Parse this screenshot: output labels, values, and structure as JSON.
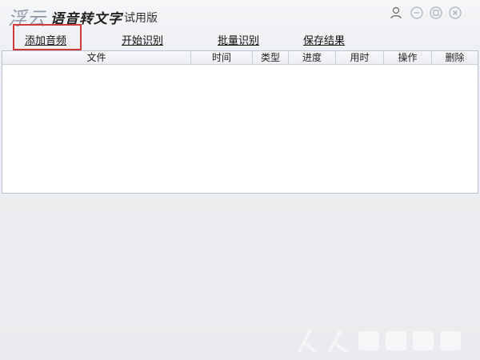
{
  "app": {
    "logo": "浮云",
    "title": "语音转文字",
    "edition": "试用版"
  },
  "window_controls": {
    "icons": [
      "user-icon",
      "minimize-icon",
      "maximize-icon",
      "close-icon"
    ]
  },
  "toolbar": {
    "add_audio": "添加音频",
    "start_recognition": "开始识别",
    "batch_recognition": "批量识别",
    "save_result": "保存结果"
  },
  "table": {
    "columns": [
      "文件",
      "时间",
      "类型",
      "进度",
      "用时",
      "操作",
      "删除"
    ],
    "rows": []
  },
  "colors": {
    "highlight": "#d23a3a",
    "background": "#eceef1"
  },
  "watermark": "人人软件园"
}
